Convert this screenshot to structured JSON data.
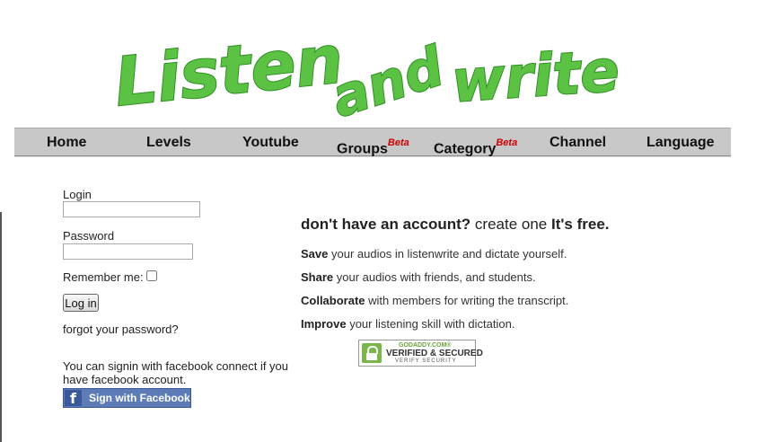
{
  "logo": {
    "word1": "Listen",
    "word2": "and",
    "word3": "write"
  },
  "nav": {
    "items": [
      {
        "label": "Home",
        "sup": ""
      },
      {
        "label": "Levels",
        "sup": ""
      },
      {
        "label": "Youtube",
        "sup": ""
      },
      {
        "label": "Groups",
        "sup": "Beta"
      },
      {
        "label": "Category",
        "sup": "Beta"
      },
      {
        "label": "Channel",
        "sup": ""
      },
      {
        "label": "Language",
        "sup": ""
      }
    ]
  },
  "login": {
    "login_label": "Login",
    "login_value": "",
    "password_label": "Password",
    "password_value": "",
    "remember_label": "Remember me:",
    "remember_checked": false,
    "submit_label": "Log in",
    "forgot_label": "forgot your password?",
    "facebook_text": "You can signin with facebook connect if you have facebook account.",
    "facebook_button": "Sign with Facebook",
    "facebook_icon": "f"
  },
  "promo": {
    "headline_bold1": "don't have an account?",
    "headline_normal": "create one",
    "headline_bold2": "It's free.",
    "features": [
      {
        "bold": "Save",
        "text": "your audios in listenwrite and dictate yourself."
      },
      {
        "bold": "Share",
        "text": "your audios with friends, and students."
      },
      {
        "bold": "Collaborate",
        "text": "with members for writing the transcript."
      },
      {
        "bold": "Improve",
        "text": "your listening skill with dictation."
      }
    ]
  },
  "seal": {
    "line1": "GODADDY.COM®",
    "line2": "VERIFIED & SECURED",
    "line3": "VERIFY SECURITY"
  },
  "colors": {
    "logo_green": "#5cc244",
    "nav_bg": "#c8c8c8",
    "beta_red": "#cc0000",
    "facebook_blue": "#3b5998"
  }
}
